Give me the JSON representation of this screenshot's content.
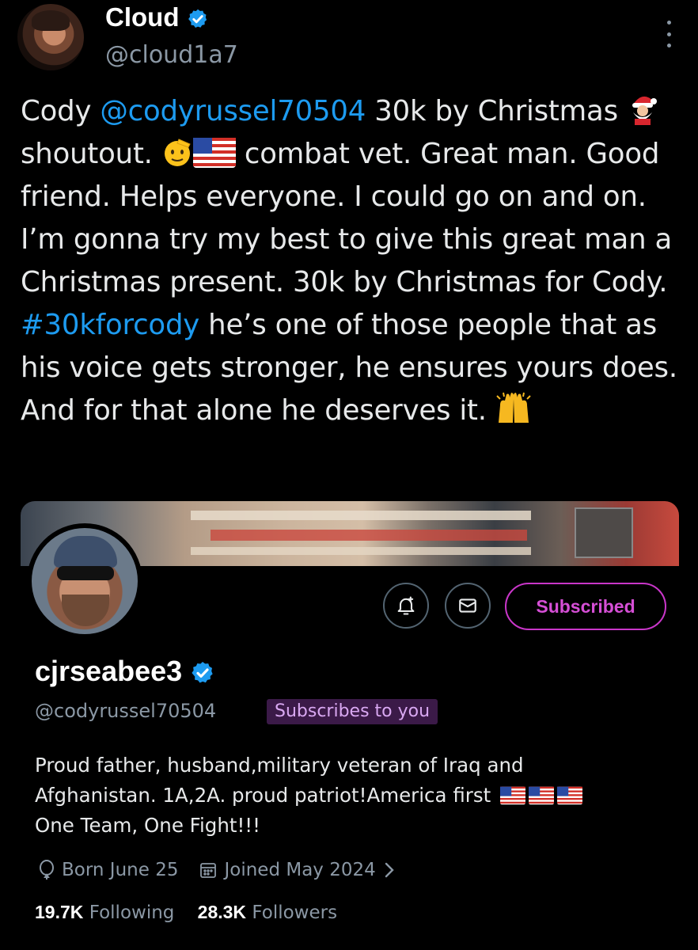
{
  "tweet": {
    "author_name": "Cloud",
    "author_handle": "@cloud1a7",
    "text_parts": {
      "p1": "Cody ",
      "mention": "@codyrussel70504",
      "p2": " 30k by Christmas ",
      "p3": " shoutout. ",
      "p4": " combat vet. Great man. Good friend. Helps everyone. I could go on and on. I’m gonna try my best to give this great man a Christmas present. 30k by Christmas for Cody. ",
      "hashtag": "#30kforcody",
      "p5": " he’s one of those people that as his voice gets stronger, he ensures yours does.  And for that alone he deserves it. "
    },
    "emojis": [
      "santa-icon",
      "saluting-face-icon",
      "us-flag-icon",
      "raising-hands-icon"
    ]
  },
  "profile_card": {
    "display_name": "cjrseabee3",
    "handle": "@codyrussel70504",
    "badge": "Subscribes to you",
    "subscribe_button": "Subscribed",
    "bio_line1": "Proud father, husband,military veteran of Iraq and",
    "bio_line2": "Afghanistan. 1A,2A. proud patriot!America first",
    "bio_line3": "One Team, One Fight!!!",
    "born": "Born June 25",
    "joined": "Joined May 2024",
    "following_count": "19.7K",
    "following_label": "Following",
    "followers_count": "28.3K",
    "followers_label": "Followers",
    "accent_color": "#c936c9",
    "link_color": "#1d9bf0"
  }
}
